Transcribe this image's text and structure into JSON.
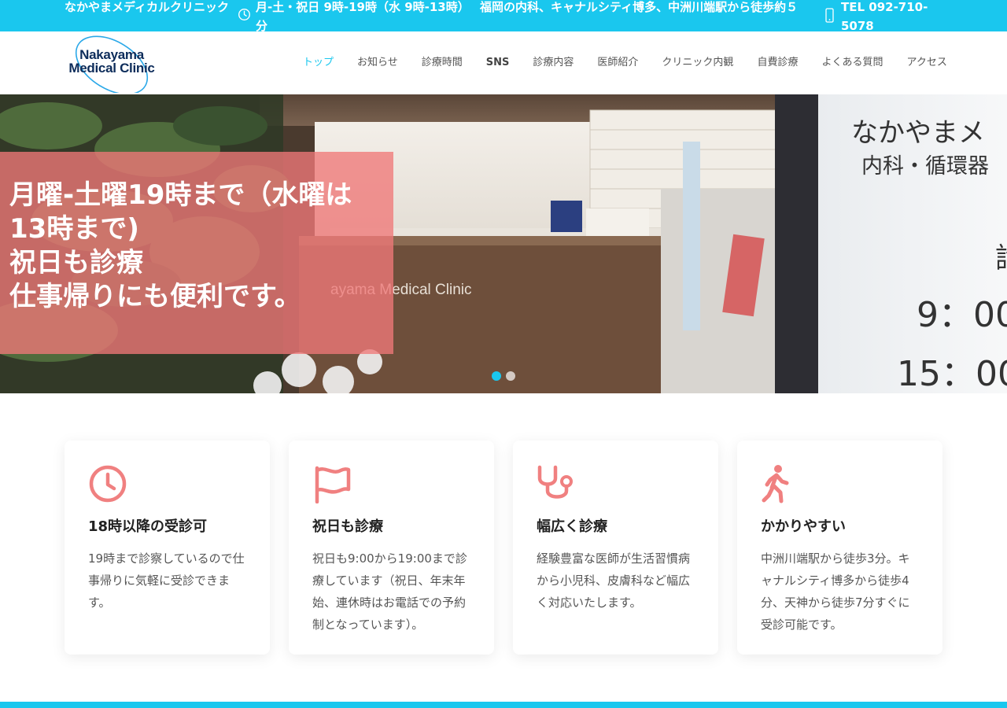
{
  "colors": {
    "accent": "#1ac7ee",
    "coral": "#f08080"
  },
  "topbar": {
    "clinic_name": "なかやまメディカルクリニック",
    "hours": "月-土・祝日 9時-19時（水 9時-13時）",
    "hours_tail": "分",
    "description": "福岡の内科、キャナルシティ博多、中洲川端駅から徒歩約５",
    "tel": "TEL 092-710-5078"
  },
  "header": {
    "logo_line1": "Nakayama",
    "logo_line2": "Medical Clinic",
    "nav": [
      {
        "label": "トップ"
      },
      {
        "label": "お知らせ"
      },
      {
        "label": "診療時間"
      },
      {
        "label": "SNS"
      },
      {
        "label": "診療内容"
      },
      {
        "label": "医師紹介"
      },
      {
        "label": "クリニック内観"
      },
      {
        "label": "自費診療"
      },
      {
        "label": "よくある質問"
      },
      {
        "label": "アクセス"
      }
    ]
  },
  "hero": {
    "line1": "月曜-土曜19時まで（水曜は",
    "line2": "13時まで)",
    "line3": "祝日も診療",
    "line4": "仕事帰りにも便利です。",
    "photo_sign": "ayama Medical Clinic",
    "photo_glass_title": "なかやまメ",
    "photo_glass_dept": "内科・循環器",
    "photo_glass_char": "診",
    "photo_glass_time1": "9：00",
    "photo_glass_time2": "15：00",
    "slide_count": 2,
    "active_slide": 1
  },
  "features": [
    {
      "icon": "clock-icon",
      "title": "18時以降の受診可",
      "text": "19時まで診察しているので仕事帰りに気軽に受診できます。"
    },
    {
      "icon": "flag-icon",
      "title": "祝日も診療",
      "text": "祝日も9:00から19:00まで診療しています（祝日、年末年始、連休時はお電話での予約制となっています）。"
    },
    {
      "icon": "stethoscope-icon",
      "title": "幅広く診療",
      "text": "経験豊富な医師が生活習慣病から小児科、皮膚科など幅広く対応いたします。"
    },
    {
      "icon": "walking-icon",
      "title": "かかりやすい",
      "text": "中洲川端駅から徒歩3分。キャナルシティ博多から徒歩4分、天神から徒歩7分すぐに受診可能です。"
    }
  ]
}
